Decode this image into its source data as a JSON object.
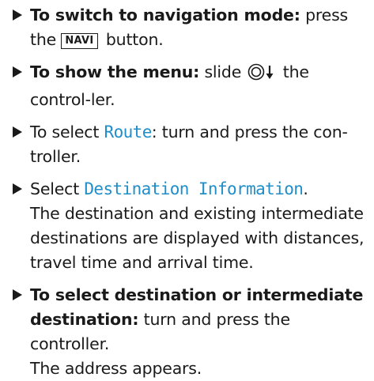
{
  "steps": [
    {
      "bold": "To switch to navigation mode:",
      "text1": " press the ",
      "key": "NAVI",
      "text2": " button."
    },
    {
      "bold": "To show the menu:",
      "text1": " slide ",
      "icon": "controller-slide-down-icon",
      "text2": " the control-ler."
    },
    {
      "text1": "To select ",
      "ui": "Route",
      "text2": ": turn and press the con-troller."
    },
    {
      "text1": "Select ",
      "ui": "Destination Information",
      "text2": ".",
      "result": "The destination and existing intermediate destinations are displayed with distances, travel time and arrival time."
    },
    {
      "bold": "To select destination or intermediate destination:",
      "text1": " turn and press the controller.",
      "result": "The address appears."
    }
  ],
  "colors": {
    "ui_text": "#1f8ec9",
    "body_text": "#1a1a1a"
  }
}
